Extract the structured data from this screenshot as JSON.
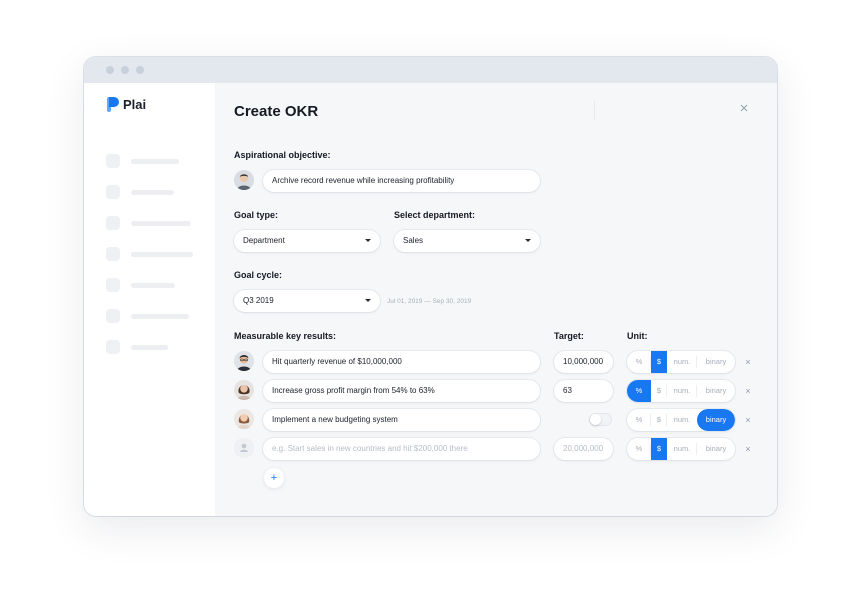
{
  "app": {
    "name": "Plai"
  },
  "form": {
    "title": "Create OKR",
    "objective": {
      "label": "Aspirational objective:",
      "value": "Archive record revenue while increasing profitability"
    },
    "goal_type": {
      "label": "Goal type:",
      "value": "Department"
    },
    "department": {
      "label": "Select department:",
      "value": "Sales"
    },
    "goal_cycle": {
      "label": "Goal cycle:",
      "value": "Q3 2019",
      "range": "Jul 01, 2019 — Sep 30, 2019"
    },
    "key_results": {
      "label": "Measurable key results:",
      "target_label": "Target:",
      "unit_label": "Unit:",
      "unit_options": [
        "%",
        "$",
        "num.",
        "binary"
      ],
      "rows": [
        {
          "text": "Hit quarterly revenue of $10,000,000",
          "target": "10,000,000",
          "unit": "$",
          "placeholder": false
        },
        {
          "text": "Increase gross profit margin from 54% to 63%",
          "target": "63",
          "unit": "%",
          "placeholder": false
        },
        {
          "text": "Implement a new budgeting system",
          "target": "",
          "unit": "binary",
          "placeholder": false,
          "toggle": false
        },
        {
          "text": "e.g. Start sales in new countries and hit $200,000 there",
          "target": "20,000,000",
          "unit": "$",
          "placeholder": true
        }
      ],
      "remove_glyph": "×",
      "add_glyph": "+"
    },
    "close_glyph": "×"
  },
  "colors": {
    "accent": "#1778f2",
    "sidebar_bg": "#ffffff",
    "main_bg": "#f6f7f9"
  }
}
